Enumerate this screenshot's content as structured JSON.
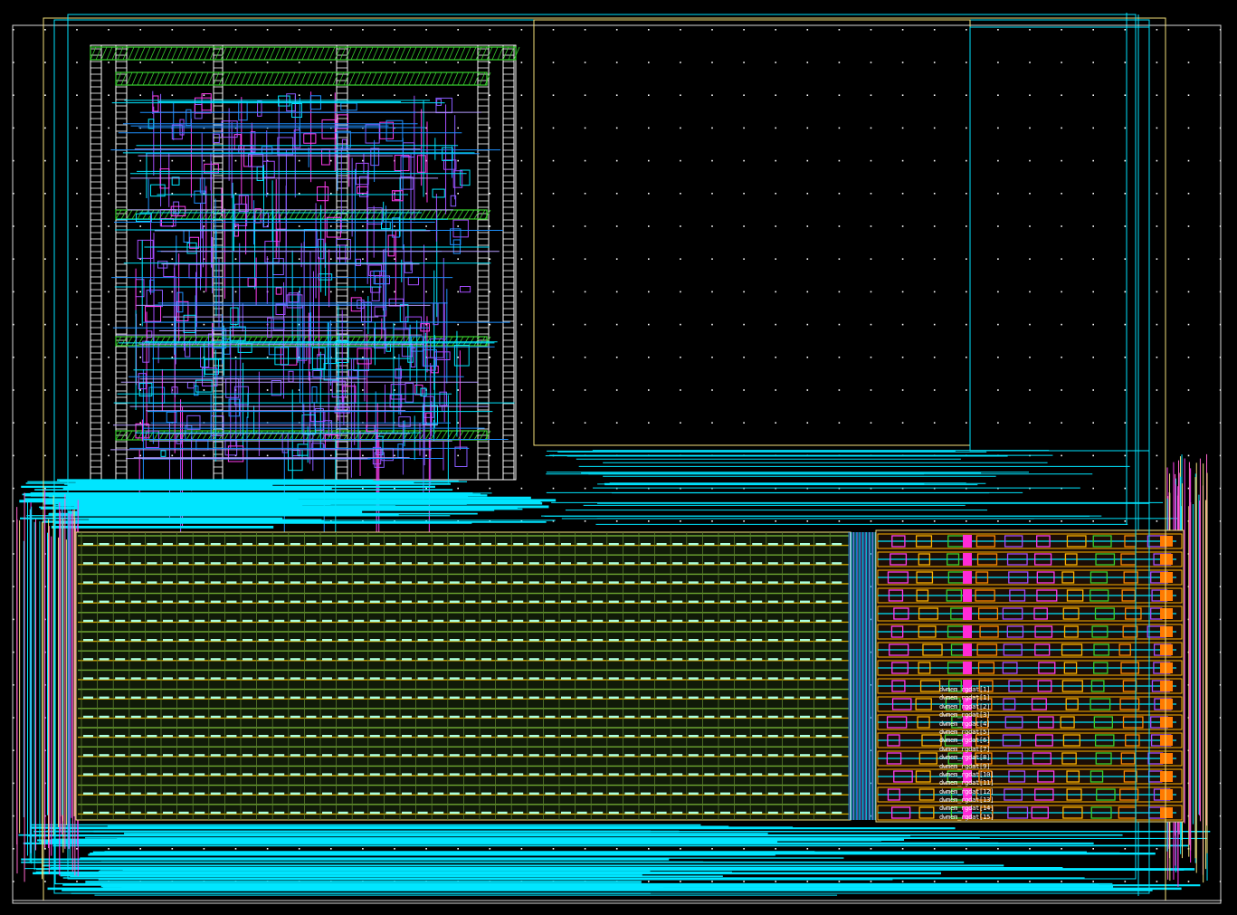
{
  "viewer": {
    "background": "#000000",
    "grid_color": "#ffffff"
  },
  "layers": {
    "metal1": "#1e90ff",
    "metal2": "#00e5ff",
    "metal3": "#a64dff",
    "poly": "#ff3df0",
    "diffusion": "#ffb300",
    "nwell": "#39d12f",
    "via": "#ffffff",
    "boundary": "#f3e07a",
    "red": "#ff2b2b"
  },
  "pin_labels": [
    "dwmem_rgdat[1]",
    "dwmem_rgdat[1]",
    "dwmem_rgdat[2]",
    "dwmem_rgdat[3]",
    "dwmem_rgdat[4]",
    "dwmem_rgdat[5]",
    "dwmem_rgdat[6]",
    "dwmem_rgdat[7]",
    "dwmem_rgdat[8]",
    "dwmem_rgdat[9]",
    "dwmem_rgdat[10]",
    "dwmem_rgdat[11]",
    "dwmem_rgdat[12]",
    "dwmem_rgdat[13]",
    "dwmem_rgdat[14]",
    "dwmem_rgdat[15]"
  ]
}
